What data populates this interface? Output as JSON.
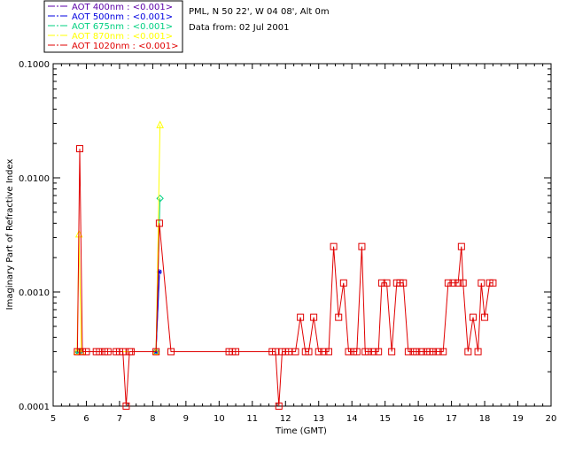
{
  "chart_data": {
    "type": "line",
    "x_scale": "linear",
    "y_scale": "log",
    "xlabel": "Time (GMT)",
    "ylabel": "Imaginary Part of Refractive Index",
    "xlim": [
      5,
      20
    ],
    "ylim": [
      0.0001,
      0.1
    ],
    "x_ticks": [
      5,
      6,
      7,
      8,
      9,
      10,
      11,
      12,
      13,
      14,
      15,
      16,
      17,
      18,
      19,
      20
    ],
    "y_ticks": [
      0.0001,
      0.001,
      0.01,
      0.1
    ],
    "y_tick_labels": [
      "0.0001",
      "0.0010",
      "0.0100",
      "0.1000"
    ],
    "info_lines": [
      "PML, N 50 22', W 04 08', Alt 0m",
      "Data from: 02 Jul 2001"
    ],
    "legend_position": "top-left outside plot",
    "grid": false,
    "series": [
      {
        "name": "AOT  400nm : <0.001>",
        "color": "#5a00a8",
        "marker": "none",
        "points": [
          [
            5.75,
            0.0003
          ],
          [
            5.8,
            0.0003
          ],
          [
            8.1,
            0.0003
          ],
          [
            8.2,
            0.0014
          ]
        ]
      },
      {
        "name": "AOT  500nm : <0.001>",
        "color": "#0000e0",
        "marker": "asterisk",
        "points": [
          [
            5.75,
            0.0003
          ],
          [
            5.8,
            0.0003
          ],
          [
            8.1,
            0.0003
          ],
          [
            8.2,
            0.0015
          ]
        ]
      },
      {
        "name": "AOT  675nm : <0.001>",
        "color": "#00d080",
        "marker": "diamond",
        "points": [
          [
            5.75,
            0.0003
          ],
          [
            5.8,
            0.0003
          ],
          [
            8.1,
            0.0003
          ],
          [
            8.22,
            0.0066
          ]
        ]
      },
      {
        "name": "AOT  870nm : <0.001>",
        "color": "#ffff00",
        "marker": "triangle",
        "points": [
          [
            5.72,
            0.0003
          ],
          [
            5.78,
            0.0032
          ],
          [
            5.85,
            0.0003
          ],
          [
            8.1,
            0.0003
          ],
          [
            8.22,
            0.029
          ]
        ]
      },
      {
        "name": "AOT 1020nm : <0.001>",
        "color": "#e00000",
        "marker": "square",
        "points": [
          [
            5.73,
            0.0003
          ],
          [
            5.8,
            0.018
          ],
          [
            5.88,
            0.0003
          ],
          [
            6.0,
            0.0003
          ],
          [
            6.3,
            0.0003
          ],
          [
            6.4,
            0.0003
          ],
          [
            6.55,
            0.0003
          ],
          [
            6.65,
            0.0003
          ],
          [
            6.9,
            0.0003
          ],
          [
            7.0,
            0.0003
          ],
          [
            7.1,
            0.0003
          ],
          [
            7.2,
            0.0001
          ],
          [
            7.3,
            0.0003
          ],
          [
            7.35,
            0.0003
          ],
          [
            8.1,
            0.0003
          ],
          [
            8.2,
            0.004
          ],
          [
            8.55,
            0.0003
          ],
          [
            10.3,
            0.0003
          ],
          [
            10.4,
            0.0003
          ],
          [
            10.5,
            0.0003
          ],
          [
            11.6,
            0.0003
          ],
          [
            11.7,
            0.0003
          ],
          [
            11.8,
            0.0001
          ],
          [
            11.9,
            0.0003
          ],
          [
            12.0,
            0.0003
          ],
          [
            12.1,
            0.0003
          ],
          [
            12.3,
            0.0003
          ],
          [
            12.45,
            0.0006
          ],
          [
            12.6,
            0.0003
          ],
          [
            12.7,
            0.0003
          ],
          [
            12.85,
            0.0006
          ],
          [
            13.0,
            0.0003
          ],
          [
            13.15,
            0.0003
          ],
          [
            13.3,
            0.0003
          ],
          [
            13.45,
            0.0025
          ],
          [
            13.6,
            0.0006
          ],
          [
            13.75,
            0.0012
          ],
          [
            13.9,
            0.0003
          ],
          [
            14.05,
            0.0003
          ],
          [
            14.15,
            0.0003
          ],
          [
            14.3,
            0.0025
          ],
          [
            14.4,
            0.0003
          ],
          [
            14.5,
            0.0003
          ],
          [
            14.65,
            0.0003
          ],
          [
            14.8,
            0.0003
          ],
          [
            14.9,
            0.0012
          ],
          [
            15.05,
            0.0012
          ],
          [
            15.2,
            0.0003
          ],
          [
            15.35,
            0.0012
          ],
          [
            15.45,
            0.0012
          ],
          [
            15.55,
            0.0012
          ],
          [
            15.7,
            0.0003
          ],
          [
            15.85,
            0.0003
          ],
          [
            15.95,
            0.0003
          ],
          [
            16.1,
            0.0003
          ],
          [
            16.25,
            0.0003
          ],
          [
            16.35,
            0.0003
          ],
          [
            16.45,
            0.0003
          ],
          [
            16.6,
            0.0003
          ],
          [
            16.75,
            0.0003
          ],
          [
            16.9,
            0.0012
          ],
          [
            17.05,
            0.0012
          ],
          [
            17.2,
            0.0012
          ],
          [
            17.3,
            0.0025
          ],
          [
            17.35,
            0.0012
          ],
          [
            17.5,
            0.0003
          ],
          [
            17.65,
            0.0006
          ],
          [
            17.8,
            0.0003
          ],
          [
            17.9,
            0.0012
          ],
          [
            18.0,
            0.0006
          ],
          [
            18.15,
            0.0012
          ],
          [
            18.25,
            0.0012
          ]
        ]
      }
    ]
  }
}
